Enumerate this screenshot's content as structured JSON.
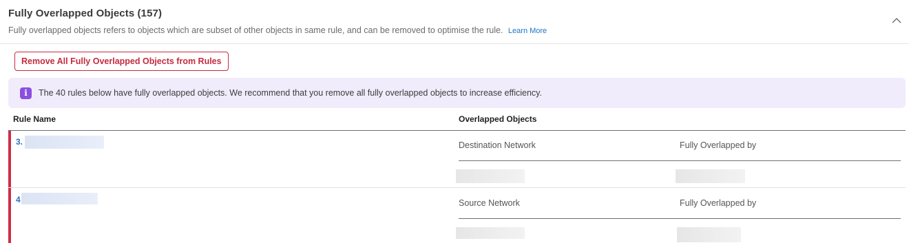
{
  "section": {
    "title": "Fully Overlapped Objects (157)",
    "description": "Fully overlapped objects refers to objects which are subset of other objects in same rule, and can be removed to optimise the rule.",
    "learn_more": "Learn More",
    "collapse_icon": "chevron-up-icon"
  },
  "actions": {
    "remove_all_label": "Remove All Fully Overlapped Objects from Rules"
  },
  "info_banner": {
    "icon": "info-icon",
    "icon_glyph": "i",
    "text": "The 40 rules below have fully overlapped objects. We recommend that you remove all fully overlapped objects to increase efficiency."
  },
  "table": {
    "columns": [
      "Rule Name",
      "Overlapped Objects"
    ],
    "rows": [
      {
        "rule_number": "3.",
        "object_type": "Destination Network",
        "overlapped_by_label": "Fully Overlapped by"
      },
      {
        "rule_number": "4",
        "object_type": "Source Network",
        "overlapped_by_label": "Fully Overlapped by"
      }
    ]
  },
  "colors": {
    "accent_red": "#c42b3c",
    "row_marker": "#cf2e47",
    "link_blue": "#1b75c9",
    "info_bg": "#f1ecfb",
    "info_icon": "#8a4fe0"
  }
}
